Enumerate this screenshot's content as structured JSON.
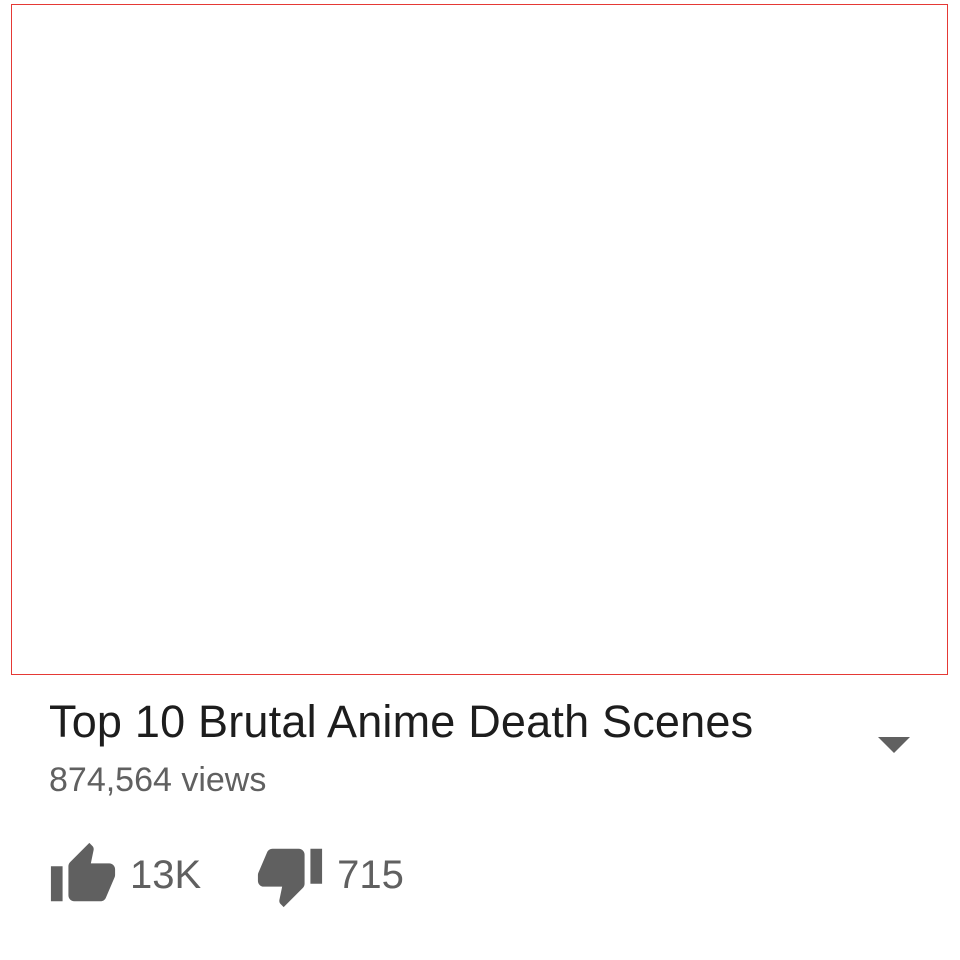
{
  "video": {
    "title": "Top 10 Brutal Anime Death Scenes",
    "views": "874,564 views"
  },
  "actions": {
    "like_count": "13K",
    "dislike_count": "715"
  },
  "icons": {
    "like": "thumbs-up-icon",
    "dislike": "thumbs-down-icon",
    "expand": "caret-down-icon"
  },
  "colors": {
    "frame_border": "#e53935",
    "title_text": "#1d1d1d",
    "secondary_text": "#606060",
    "icon": "#606060"
  }
}
